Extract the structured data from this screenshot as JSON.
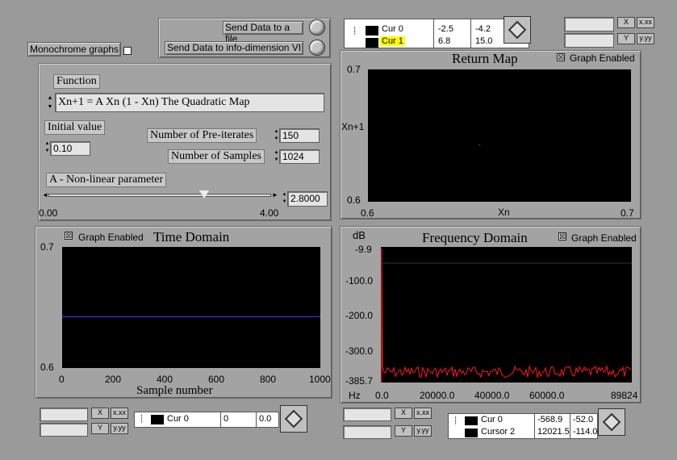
{
  "top": {
    "monochrome_label": "Monochrome graphs",
    "send_file_label": "Send Data to a file",
    "send_info_label": "Send Data to info-dimension VI"
  },
  "controls": {
    "function_label": "Function",
    "function_value": "Xn+1  = A Xn (1 - Xn)    The Quadratic Map",
    "initial_label": "Initial value",
    "initial_value": "0.10",
    "preiter_label": "Number of Pre-iterates",
    "preiter_value": "150",
    "samples_label": "Number of Samples",
    "samples_value": "1024",
    "param_label": "A - Non-linear parameter",
    "param_value": "2.8000",
    "slider_min": "0.00",
    "slider_max": "4.00",
    "slider_level": 0.7
  },
  "return_map": {
    "title": "Return Map",
    "graph_enabled": "Graph Enabled",
    "ylabel": "Xn+1",
    "xlabel": "Xn",
    "y_top": "0.7",
    "y_bottom": "0.6",
    "x_left": "0.6",
    "x_right": "0.7",
    "legend": {
      "cur0_name": "Cur 0",
      "cur0_x": "-2.5",
      "cur0_y": "-4.2",
      "cur1_name": "Cur 1",
      "cur1_x": "6.8",
      "cur1_y": "15.0"
    }
  },
  "time_domain": {
    "title": "Time Domain",
    "graph_enabled": "Graph Enabled",
    "xlabel": "Sample number",
    "y_top": "0.7",
    "y_bottom": "0.6",
    "x_ticks": [
      "0",
      "200",
      "400",
      "600",
      "800",
      "1000"
    ],
    "line_color": "#3a3aff",
    "cursor": {
      "name": "Cur 0",
      "x": "0",
      "y": "0.0"
    }
  },
  "freq_domain": {
    "title": "Frequency Domain",
    "graph_enabled": "Graph Enabled",
    "ylabel": "dB",
    "xunit": "Hz",
    "y_ticks": [
      "-9.9",
      "-100.0",
      "-200.0",
      "-300.0",
      "-385.7"
    ],
    "x_ticks": [
      "0.0",
      "20000.0",
      "40000.0",
      "60000.0",
      "89824"
    ],
    "line_color": "#ff1a1a",
    "cursors": {
      "c0_name": "Cur 0",
      "c0_x": "-568.9",
      "c0_y": "-52.0",
      "c2_name": "Cursor 2",
      "c2_x": "12021.5",
      "c2_y": "-114.0"
    }
  },
  "palette_labels": {
    "x_scale": "X",
    "y_scale": "Y",
    "fmt_x": "x.xx",
    "fmt_y": "y.yy"
  }
}
